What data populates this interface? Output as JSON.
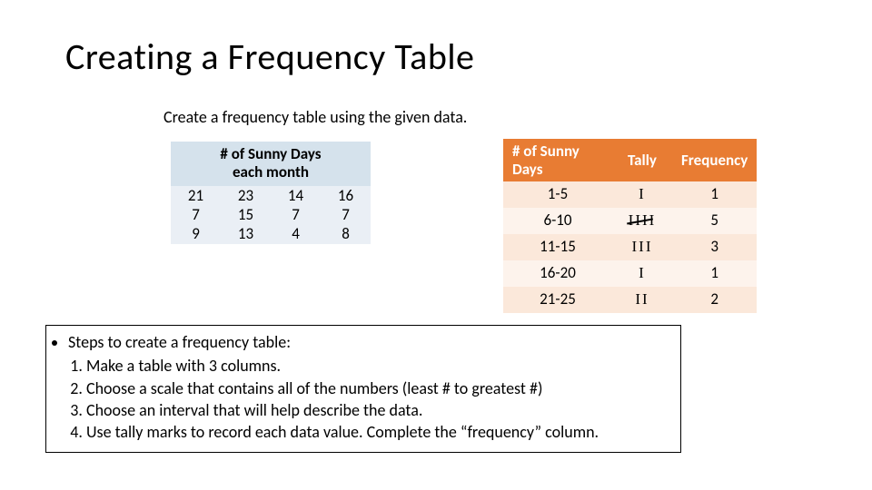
{
  "title": "Creating a Frequency Table",
  "subtitle": "Create a frequency table using the given data.",
  "data_box": {
    "heading_line1": "# of Sunny Days",
    "heading_line2": "each month",
    "rows": [
      [
        "21",
        "23",
        "14",
        "16"
      ],
      [
        "7",
        "15",
        "7",
        "7"
      ],
      [
        "9",
        "13",
        "4",
        "8"
      ]
    ]
  },
  "freq_table": {
    "headers": {
      "col1_line1": "# of Sunny",
      "col1_line2": "Days",
      "col2": "Tally",
      "col3": "Frequency"
    },
    "rows": [
      {
        "range": "1-5",
        "tally": "I",
        "tally_style": "plain",
        "freq": "1"
      },
      {
        "range": "6-10",
        "tally": "IIII",
        "tally_style": "five",
        "freq": "5"
      },
      {
        "range": "11-15",
        "tally": "III",
        "tally_style": "plain",
        "freq": "3"
      },
      {
        "range": "16-20",
        "tally": "I",
        "tally_style": "plain",
        "freq": "1"
      },
      {
        "range": "21-25",
        "tally": "II",
        "tally_style": "plain",
        "freq": "2"
      }
    ]
  },
  "steps": {
    "lead": "Steps to create a frequency table:",
    "items": [
      "Make a table with 3 columns.",
      "Choose a scale that contains all of the numbers (least # to greatest #)",
      "Choose an interval that will help describe the data.",
      "Use tally marks to record each data value. Complete the “frequency” column."
    ]
  },
  "chart_data": {
    "type": "table",
    "title": "Frequency table of # of Sunny Days each month",
    "raw_values": [
      21,
      23,
      14,
      16,
      7,
      15,
      7,
      7,
      9,
      13,
      4,
      8
    ],
    "categories": [
      "1-5",
      "6-10",
      "11-15",
      "16-20",
      "21-25"
    ],
    "values": [
      1,
      5,
      3,
      1,
      2
    ],
    "columns": [
      "# of Sunny Days",
      "Tally",
      "Frequency"
    ]
  }
}
